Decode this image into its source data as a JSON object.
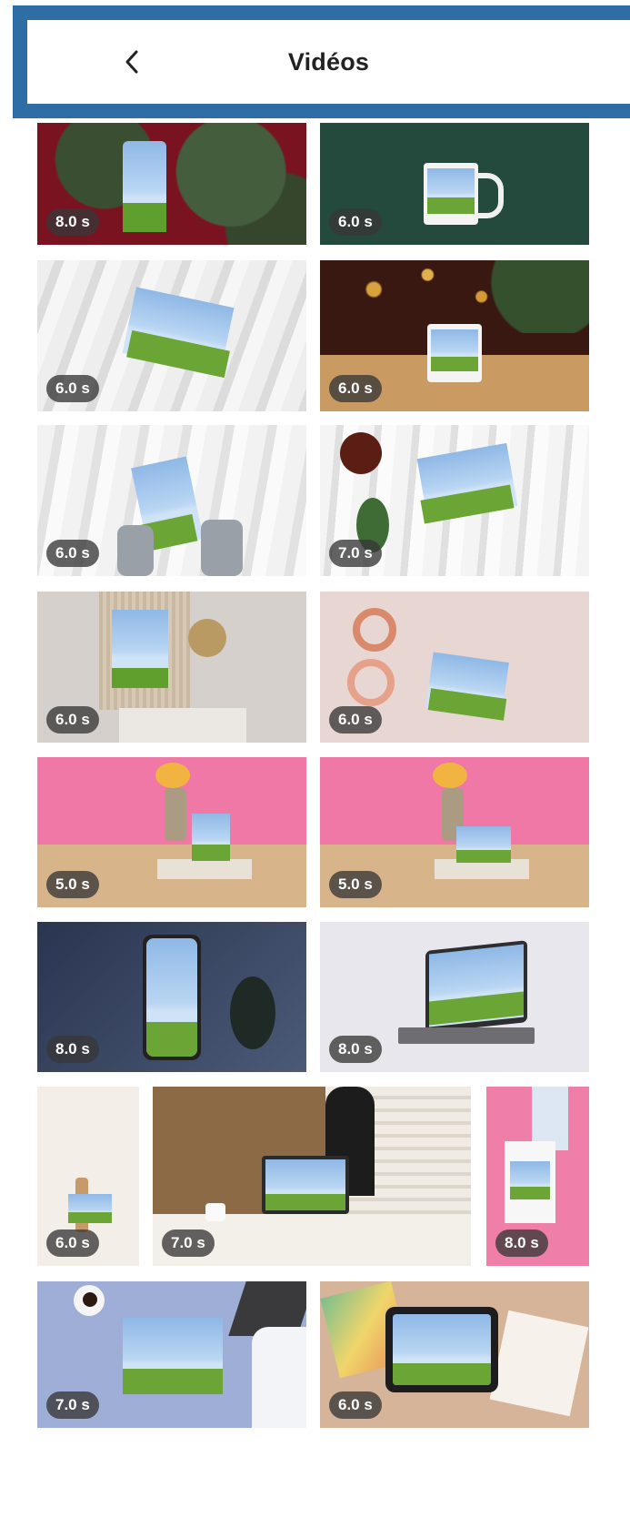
{
  "header": {
    "title": "Vidéos",
    "back_icon": "chevron-left-icon"
  },
  "videos": [
    {
      "duration": "8.0 s",
      "scene": "gift tag on pine branches, dark red background"
    },
    {
      "duration": "6.0 s",
      "scene": "white mug on dark green background"
    },
    {
      "duration": "6.0 s",
      "scene": "postcard on draped white fabric"
    },
    {
      "duration": "6.0 s",
      "scene": "mug on table with bokeh lights"
    },
    {
      "duration": "6.0 s",
      "scene": "hands holding card among branches"
    },
    {
      "duration": "7.0 s",
      "scene": "card with coffee cup and ribbon"
    },
    {
      "duration": "6.0 s",
      "scene": "framed print with ornament and marble"
    },
    {
      "duration": "6.0 s",
      "scene": "hands holding card with glasses"
    },
    {
      "duration": "5.0 s",
      "scene": "card on desk with flowers, pink wall"
    },
    {
      "duration": "5.0 s",
      "scene": "card on desk with flowers and pencil, pink wall"
    },
    {
      "duration": "8.0 s",
      "scene": "smartphone on dark blue background with plant"
    },
    {
      "duration": "8.0 s",
      "scene": "laptop on light grey background"
    },
    {
      "duration": "6.0 s",
      "scene": "small card with dried flowers"
    },
    {
      "duration": "7.0 s",
      "scene": "laptop on desk with lamp"
    },
    {
      "duration": "8.0 s",
      "scene": "tote bag held on pink background"
    },
    {
      "duration": "7.0 s",
      "scene": "card on blue desk with laptop and coffee"
    },
    {
      "duration": "6.0 s",
      "scene": "tablet with paintings on beige surface"
    }
  ],
  "colors": {
    "header_frame": "#2f6ea5",
    "badge_bg": "rgba(55,55,55,0.78)",
    "sky": "#a9cdef",
    "grass": "#6fa83a"
  }
}
